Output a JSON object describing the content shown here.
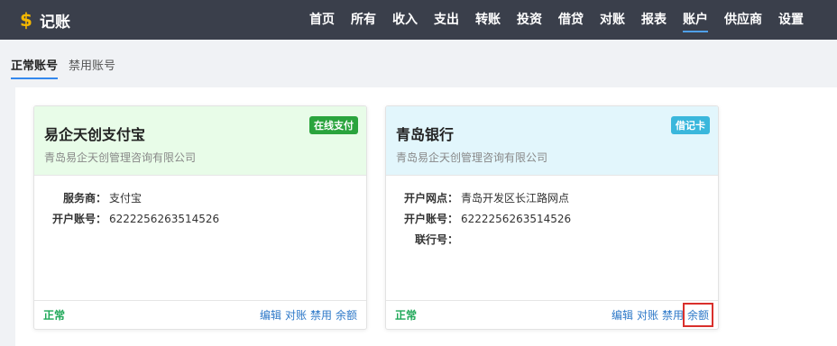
{
  "app": {
    "logo_symbol": "$",
    "title": "记账"
  },
  "nav": {
    "items": [
      "首页",
      "所有",
      "收入",
      "支出",
      "转账",
      "投资",
      "借贷",
      "对账",
      "报表",
      "账户",
      "供应商",
      "设置"
    ],
    "active": "账户"
  },
  "tabs": {
    "normal": "正常账号",
    "disabled": "禁用账号",
    "active": "正常账号"
  },
  "colors": {
    "header_bg": "#3a3f4b",
    "card1_head_bg": "#e8fce8",
    "card2_head_bg": "#e2f6fc",
    "badge_green": "#2aa43d",
    "badge_cyan": "#3ab7dc",
    "status_green": "#1fa858",
    "link_blue": "#2d78c8",
    "highlight_red": "#d9302c"
  },
  "cards": [
    {
      "title": "易企天创支付宝",
      "subtitle": "青岛易企天创管理咨询有限公司",
      "badge": "在线支付",
      "rows": [
        {
          "label": "服务商：",
          "value": "支付宝"
        },
        {
          "label": "开户账号：",
          "value": "6222256263514526"
        }
      ],
      "status": "正常",
      "actions": [
        "编辑",
        "对账",
        "禁用",
        "余额"
      ]
    },
    {
      "title": "青岛银行",
      "subtitle": "青岛易企天创管理咨询有限公司",
      "badge": "借记卡",
      "rows": [
        {
          "label": "开户网点：",
          "value": "青岛开发区长江路网点"
        },
        {
          "label": "开户账号：",
          "value": "6222256263514526"
        },
        {
          "label": "联行号：",
          "value": ""
        }
      ],
      "status": "正常",
      "actions": [
        "编辑",
        "对账",
        "禁用",
        "余额"
      ]
    }
  ]
}
